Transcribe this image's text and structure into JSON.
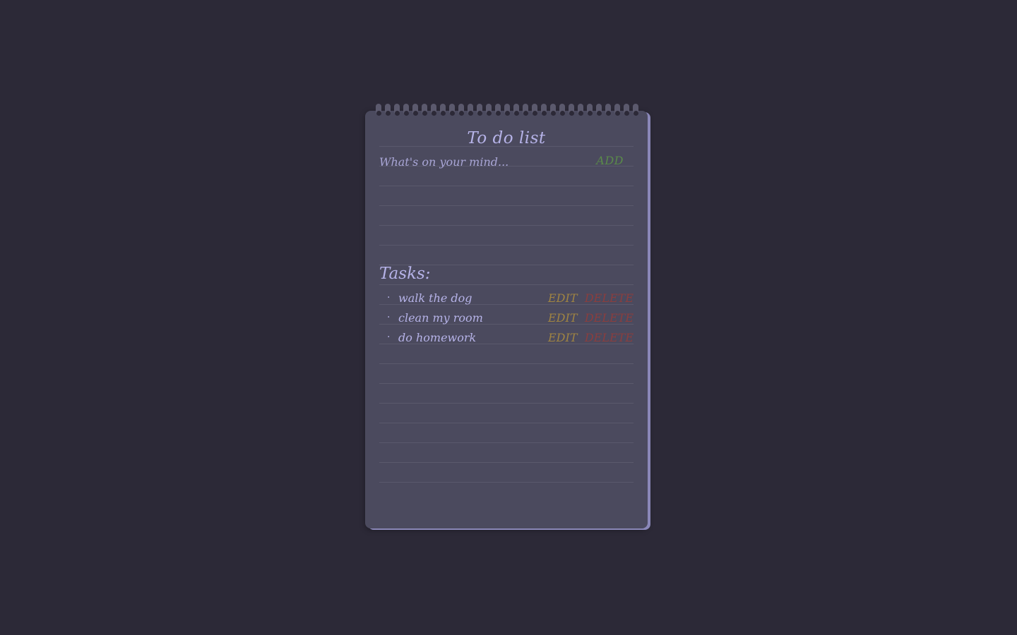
{
  "app": {
    "title": "To do list"
  },
  "input": {
    "placeholder": "What's on your mind...",
    "value": "",
    "add_label": "ADD"
  },
  "tasks_section": {
    "heading": "Tasks:",
    "items": [
      {
        "text": "walk the dog",
        "edit_label": "EDIT",
        "delete_label": "DELETE"
      },
      {
        "text": "clean my room",
        "edit_label": "EDIT",
        "delete_label": "DELETE"
      },
      {
        "text": "do homework",
        "edit_label": "EDIT",
        "delete_label": "DELETE"
      }
    ],
    "bullet": "·"
  },
  "colors": {
    "background": "#2c2937",
    "paper": "#4b4a5e",
    "text": "#b6b3e8",
    "add": "#5a8a4a",
    "edit": "#a08442",
    "delete": "#8a3e3e"
  }
}
